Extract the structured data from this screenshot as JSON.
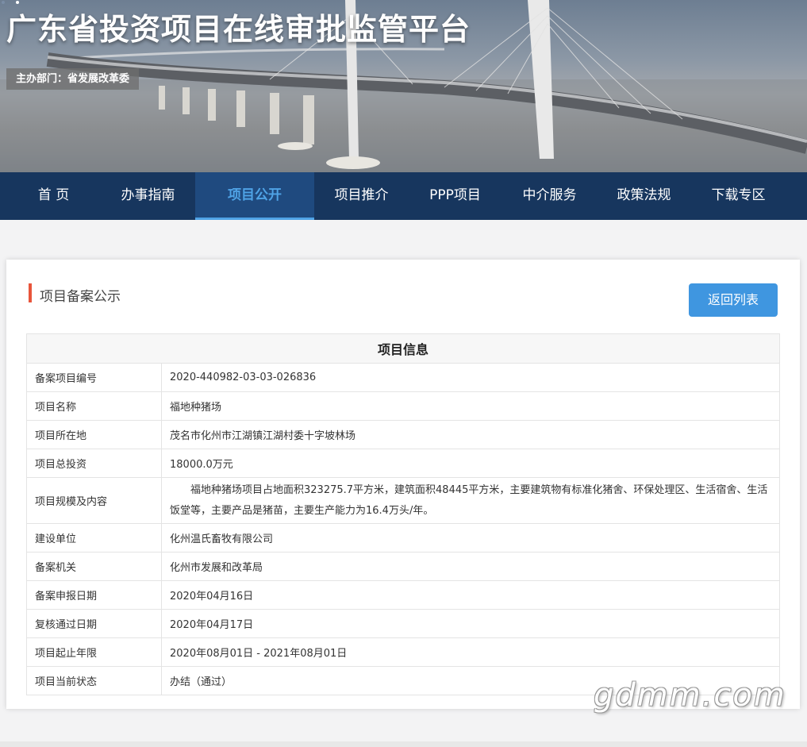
{
  "banner": {
    "title": "广东省投资项目在线审批监管平台",
    "sponsor": "主办部门：省发展改革委"
  },
  "nav": {
    "items": [
      {
        "label": "首 页"
      },
      {
        "label": "办事指南"
      },
      {
        "label": "项目公开",
        "active": true
      },
      {
        "label": "项目推介"
      },
      {
        "label": "PPP项目"
      },
      {
        "label": "中介服务"
      },
      {
        "label": "政策法规"
      },
      {
        "label": "下载专区"
      }
    ]
  },
  "card": {
    "title": "项目备案公示",
    "back_label": "返回列表",
    "table_title": "项目信息",
    "rows": [
      {
        "label": "备案项目编号",
        "value": "2020-440982-03-03-026836"
      },
      {
        "label": "项目名称",
        "value": "福地种猪场"
      },
      {
        "label": "项目所在地",
        "value": "茂名市化州市江湖镇江湖村委十字坡林场"
      },
      {
        "label": "项目总投资",
        "value": "18000.0万元"
      },
      {
        "label": "项目规模及内容",
        "value": "福地种猪场项目占地面积323275.7平方米，建筑面积48445平方米，主要建筑物有标准化猪舍、环保处理区、生活宿舍、生活饭堂等，主要产品是猪苗，主要生产能力为16.4万头/年。"
      },
      {
        "label": "建设单位",
        "value": "化州温氏畜牧有限公司"
      },
      {
        "label": "备案机关",
        "value": "化州市发展和改革局"
      },
      {
        "label": "备案申报日期",
        "value": "2020年04月16日"
      },
      {
        "label": "复核通过日期",
        "value": "2020年04月17日"
      },
      {
        "label": "项目起止年限",
        "value": "2020年08月01日 - 2021年08月01日"
      },
      {
        "label": "项目当前状态",
        "value": "办结（通过）"
      }
    ]
  },
  "watermark": "gdmm.com",
  "colors": {
    "nav_bg": "#17365e",
    "nav_active": "#4fa3e6",
    "button_bg": "#3f96e0",
    "title_bar_accent": "#e8553b"
  }
}
